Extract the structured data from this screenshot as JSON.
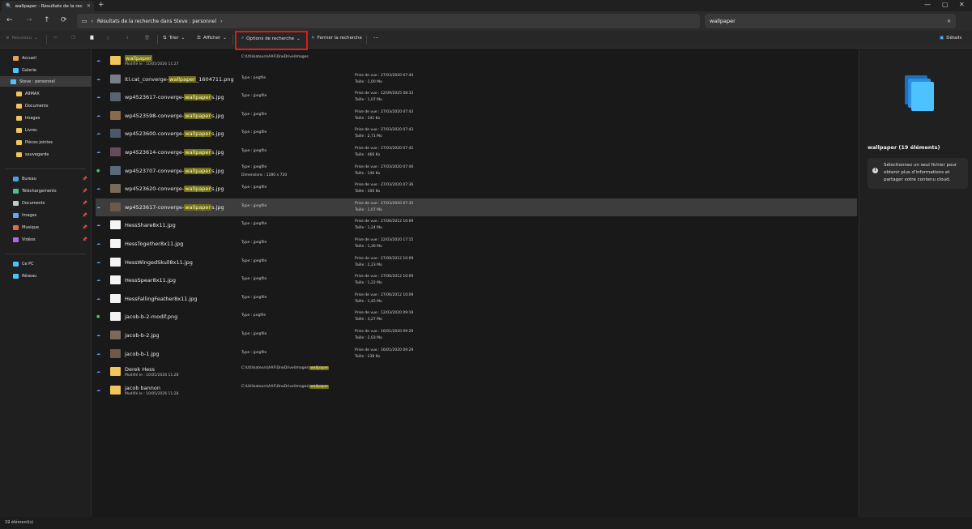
{
  "window": {
    "tab_title": "wallpaper - Résultats de la rec",
    "new_tab_glyph": "+",
    "close_glyph": "✕",
    "minimize_glyph": "—",
    "maximize_glyph": "▢"
  },
  "address": {
    "breadcrumb_root": "Résultats de la recherche dans Steve : personnel",
    "chevron": "›",
    "search_value": "wallpaper"
  },
  "toolbar": {
    "new_label": "Nouveau",
    "sort_label": "Trier",
    "view_label": "Afficher",
    "search_options_label": "Options de recherche",
    "close_search_label": "Fermer la recherche",
    "more_label": "···",
    "details_label": "Détails"
  },
  "sidebar": {
    "items": [
      {
        "label": "Accueil",
        "icon": "home-icon"
      },
      {
        "label": "Galerie",
        "icon": "gallery-icon"
      },
      {
        "label": "Steve : personnel",
        "icon": "onedrive-icon"
      },
      {
        "label": "A9MAX",
        "icon": "folder-icon"
      },
      {
        "label": "Documents",
        "icon": "folder-icon"
      },
      {
        "label": "Images",
        "icon": "folder-icon"
      },
      {
        "label": "Livres",
        "icon": "folder-icon"
      },
      {
        "label": "Pièces jointes",
        "icon": "folder-icon"
      },
      {
        "label": "sauvegarde",
        "icon": "folder-icon"
      }
    ],
    "quick": [
      {
        "label": "Bureau",
        "icon": "desktop-icon"
      },
      {
        "label": "Téléchargements",
        "icon": "download-icon"
      },
      {
        "label": "Documents",
        "icon": "documents-icon"
      },
      {
        "label": "Images",
        "icon": "pictures-icon"
      },
      {
        "label": "Musique",
        "icon": "music-icon"
      },
      {
        "label": "Vidéos",
        "icon": "videos-icon"
      }
    ],
    "pin_glyph": "📌",
    "thispc": "Ce PC",
    "network": "Réseau"
  },
  "files": [
    {
      "pre": "",
      "hl": "wallpaper",
      "post": "",
      "kind": "folder",
      "mod": "Modifié le : 10/05/2026 11:27",
      "col2": "C:\\Utilisateurs\\AAF\\OneDrive\\Images",
      "col2b": "",
      "taken": "",
      "size": "",
      "cloud": "blue"
    },
    {
      "pre": "itl.cat_converge-",
      "hl": "wallpaper",
      "post": "_1604711.png",
      "kind": "img",
      "mod": "",
      "col2": "Type : pngfile",
      "col2b": "",
      "taken": "Prise de vue : 27/03/2020 07:44",
      "size": "Taille : 1,00 Mo",
      "cloud": "blue"
    },
    {
      "pre": "wp4523617-converge-",
      "hl": "wallpaper",
      "post": "s.jpg",
      "kind": "img",
      "mod": "",
      "col2": "Type : jpegfile",
      "col2b": "",
      "taken": "Prise de vue : 12/09/2025 08:33",
      "size": "Taille : 1,07 Mo",
      "cloud": "blue"
    },
    {
      "pre": "wp4523598-converge-",
      "hl": "wallpaper",
      "post": "s.jpg",
      "kind": "img",
      "mod": "",
      "col2": "Type : jpegfile",
      "col2b": "",
      "taken": "Prise de vue : 27/03/2020 07:43",
      "size": "Taille : 341 Ko",
      "cloud": "blue"
    },
    {
      "pre": "wp4523600-converge-",
      "hl": "wallpaper",
      "post": "s.jpg",
      "kind": "img",
      "mod": "",
      "col2": "Type : jpegfile",
      "col2b": "",
      "taken": "Prise de vue : 27/03/2020 07:43",
      "size": "Taille : 2,71 Mo",
      "cloud": "blue"
    },
    {
      "pre": "wp4523614-converge-",
      "hl": "wallpaper",
      "post": "s.jpg",
      "kind": "img",
      "mod": "",
      "col2": "Type : jpegfile",
      "col2b": "",
      "taken": "Prise de vue : 27/03/2020 07:42",
      "size": "Taille : 466 Ko",
      "cloud": "blue"
    },
    {
      "pre": "wp4523707-converge-",
      "hl": "wallpaper",
      "post": "s.jpg",
      "kind": "img",
      "mod": "",
      "col2": "Type : jpegfile",
      "col2b": "Dimensions : 1280 x 720",
      "taken": "Prise de vue : 27/03/2020 07:40",
      "size": "Taille : 146 Ko",
      "cloud": "green"
    },
    {
      "pre": "wp4523620-converge-",
      "hl": "wallpaper",
      "post": "s.jpg",
      "kind": "img",
      "mod": "",
      "col2": "Type : jpegfile",
      "col2b": "",
      "taken": "Prise de vue : 27/03/2020 07:36",
      "size": "Taille : 100 Ko",
      "cloud": "blue"
    },
    {
      "pre": "wp4523617-converge-",
      "hl": "wallpaper",
      "post": "s.jpg",
      "kind": "img",
      "mod": "",
      "col2": "Type : jpegfile",
      "col2b": "",
      "taken": "Prise de vue : 27/03/2020 07:35",
      "size": "Taille : 1,07 Mo",
      "cloud": "blue",
      "selected": true
    },
    {
      "pre": "HessShare8x11.jpg",
      "hl": "",
      "post": "",
      "kind": "doc",
      "mod": "",
      "col2": "Type : jpegfile",
      "col2b": "",
      "taken": "Prise de vue : 27/06/2012 10:09",
      "size": "Taille : 1,24 Mo",
      "cloud": "blue"
    },
    {
      "pre": "HessTogether8x11.jpg",
      "hl": "",
      "post": "",
      "kind": "doc",
      "mod": "",
      "col2": "Type : jpegfile",
      "col2b": "",
      "taken": "Prise de vue : 22/03/2020 17:15",
      "size": "Taille : 1,36 Mo",
      "cloud": "blue"
    },
    {
      "pre": "HessWingedSkull8x11.jpg",
      "hl": "",
      "post": "",
      "kind": "doc",
      "mod": "",
      "col2": "Type : jpegfile",
      "col2b": "",
      "taken": "Prise de vue : 27/06/2012 10:09",
      "size": "Taille : 2,23 Mo",
      "cloud": "blue"
    },
    {
      "pre": "HessSpear8x11.jpg",
      "hl": "",
      "post": "",
      "kind": "doc",
      "mod": "",
      "col2": "Type : jpegfile",
      "col2b": "",
      "taken": "Prise de vue : 27/06/2012 10:09",
      "size": "Taille : 1,22 Mo",
      "cloud": "blue"
    },
    {
      "pre": "HessFallingFeather8x11.jpg",
      "hl": "",
      "post": "",
      "kind": "doc",
      "mod": "",
      "col2": "Type : jpegfile",
      "col2b": "",
      "taken": "Prise de vue : 27/06/2012 10:09",
      "size": "Taille : 1,45 Mo",
      "cloud": "blue"
    },
    {
      "pre": "jacob-b-2-modif.png",
      "hl": "",
      "post": "",
      "kind": "doc",
      "mod": "",
      "col2": "Type : pngfile",
      "col2b": "",
      "taken": "Prise de vue : 12/03/2020 09:19",
      "size": "Taille : 3,27 Mo",
      "cloud": "green"
    },
    {
      "pre": "jacob-b-2.jpg",
      "hl": "",
      "post": "",
      "kind": "img",
      "mod": "",
      "col2": "Type : jpegfile",
      "col2b": "",
      "taken": "Prise de vue : 16/01/2020 09:29",
      "size": "Taille : 2,03 Mo",
      "cloud": "blue"
    },
    {
      "pre": "jacob-b-1.jpg",
      "hl": "",
      "post": "",
      "kind": "img",
      "mod": "",
      "col2": "Type : jpegfile",
      "col2b": "",
      "taken": "Prise de vue : 16/01/2020 09:29",
      "size": "Taille : 138 Ko",
      "cloud": "blue"
    },
    {
      "pre": "Derek Hess",
      "hl": "",
      "post": "",
      "kind": "folder",
      "mod": "Modifié le : 10/05/2026 11:28",
      "col2": "C:\\Utilisateurs\\AAF\\OneDrive\\Images\\",
      "col2hl": "wallpaper",
      "col2b": "",
      "taken": "",
      "size": "",
      "cloud": "blue"
    },
    {
      "pre": "jacob bannon",
      "hl": "",
      "post": "",
      "kind": "folder",
      "mod": "Modifié le : 10/05/2026 11:28",
      "col2": "C:\\Utilisateurs\\AAF\\OneDrive\\Images\\",
      "col2hl": "wallpaper",
      "col2b": "",
      "taken": "",
      "size": "",
      "cloud": "blue"
    }
  ],
  "details": {
    "title": "wallpaper (19 éléments)",
    "info_glyph": "i",
    "message": "Sélectionnez un seul fichier pour obtenir plus d'informations et partager votre contenu cloud."
  },
  "status": {
    "count": "19 élément(s)"
  },
  "colors": {
    "accent": "#4cc2ff",
    "highlight": "#6f6d12",
    "folder": "#f2c55c",
    "red_box": "#d81b1b"
  }
}
